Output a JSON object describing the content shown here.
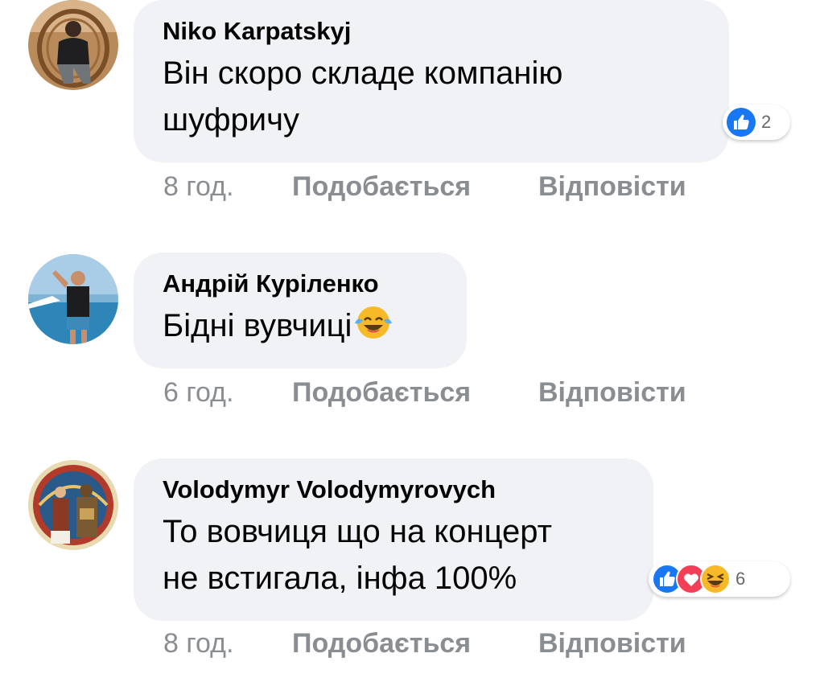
{
  "colors": {
    "bubble_bg": "#f0f2f5",
    "meta_text": "#8a8d91",
    "like_blue": "#1877f2",
    "love_red": "#f33e58",
    "haha_yellow": "#f7b928"
  },
  "comments": [
    {
      "author": "Niko Karpatskyj",
      "text_lines": [
        "Він скоро складе компанію",
        "шуфричу"
      ],
      "reactions": {
        "icons": [
          "like-icon"
        ],
        "count": "2"
      },
      "time": "8 год.",
      "like_label": "Подобається",
      "reply_label": "Відповісти"
    },
    {
      "author": "Андрій Куріленко",
      "text_lines": [
        "Бідні вувчиці"
      ],
      "emoji": "laughing-crying-emoji",
      "time": "6 год.",
      "like_label": "Подобається",
      "reply_label": "Відповісти"
    },
    {
      "author": "Volodymyr Volodymyrovych",
      "text_lines": [
        "То вовчиця що на концерт",
        "не встигала, інфа 100%"
      ],
      "reactions": {
        "icons": [
          "like-icon",
          "love-icon",
          "haha-icon"
        ],
        "count": "6"
      },
      "time": "8 год.",
      "like_label": "Подобається",
      "reply_label": "Відповісти"
    }
  ]
}
